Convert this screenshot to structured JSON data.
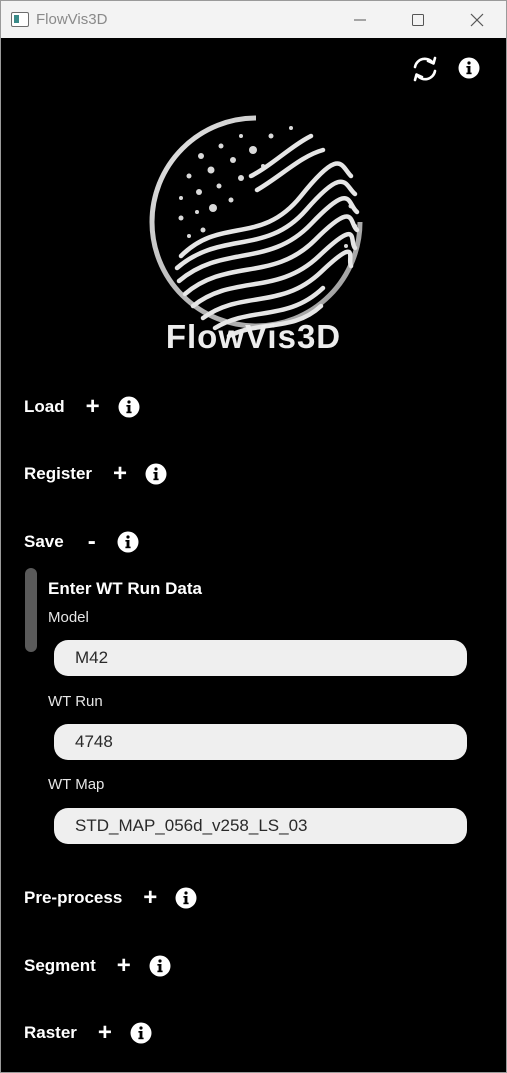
{
  "window": {
    "title": "FlowVis3D"
  },
  "header": {
    "refresh_icon": "refresh-icon",
    "info_icon": "info-icon"
  },
  "logo": {
    "text": "FlowVis3D"
  },
  "sections": [
    {
      "label": "Load",
      "toggle": "+"
    },
    {
      "label": "Register",
      "toggle": "+"
    },
    {
      "label": "Save",
      "toggle": "-"
    },
    {
      "label": "Pre-process",
      "toggle": "+"
    },
    {
      "label": "Segment",
      "toggle": "+"
    },
    {
      "label": "Raster",
      "toggle": "+"
    }
  ],
  "save_panel": {
    "title": "Enter WT Run Data",
    "fields": [
      {
        "label": "Model",
        "value": "M42"
      },
      {
        "label": "WT Run",
        "value": "4748"
      },
      {
        "label": "WT Map",
        "value": "STD_MAP_056d_v258_LS_03"
      }
    ]
  },
  "colors": {
    "background": "#000000",
    "titlebar": "#f3f3f3",
    "field_bg": "#efefef",
    "text": "#ffffff"
  }
}
